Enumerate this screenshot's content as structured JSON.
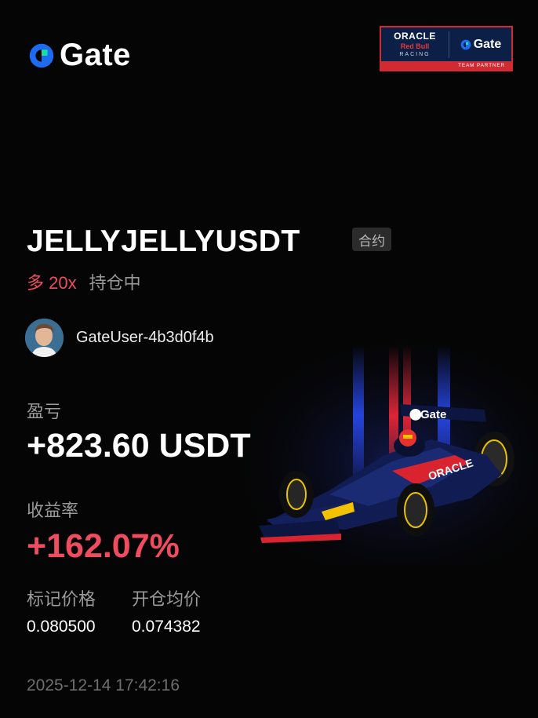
{
  "brand": {
    "logo_text": "Gate",
    "accent_blue": "#1d6bf3",
    "accent_green": "#17e0a0"
  },
  "partner_badge": {
    "oracle": "ORACLE",
    "redbull": "Red Bull",
    "racing": "RACING",
    "gate": "Gate",
    "caption": "TEAM PARTNER"
  },
  "position": {
    "pair": "JELLYJELLYUSDT",
    "tag": "合约",
    "side": "多 20x",
    "status": "持仓中",
    "side_color": "#ef4d5f"
  },
  "user": {
    "name": "GateUser-4b3d0f4b"
  },
  "stats": {
    "pnl_label": "盈亏",
    "pnl_value": "+823.60 USDT",
    "roe_label": "收益率",
    "roe_value": "+162.07%",
    "mark_price_label": "标记价格",
    "mark_price_value": "0.080500",
    "entry_price_label": "开仓均价",
    "entry_price_value": "0.074382"
  },
  "timestamp": "2025-12-14 17:42:16",
  "car_livery": {
    "wing_text": "Gate",
    "sidepod_text": "ORACLE"
  }
}
